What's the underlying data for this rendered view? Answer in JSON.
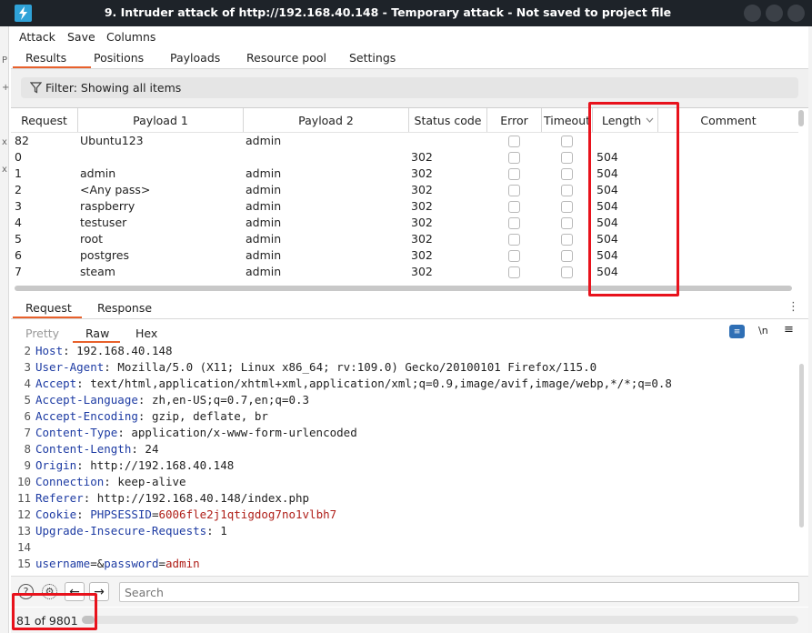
{
  "window": {
    "title": "9. Intruder attack of http://192.168.40.148 - Temporary attack - Not saved to project file",
    "icon": "burp-lightning-icon"
  },
  "left_strip": [
    "P",
    "+",
    "x",
    "x"
  ],
  "menu": [
    "Attack",
    "Save",
    "Columns"
  ],
  "tabs": [
    "Results",
    "Positions",
    "Payloads",
    "Resource pool",
    "Settings"
  ],
  "active_tab": "Results",
  "filter": {
    "text": "Filter: Showing all items",
    "icon": "filter-funnel-icon"
  },
  "results_table": {
    "columns": [
      "Request",
      "Payload 1",
      "Payload 2",
      "Status code",
      "Error",
      "Timeout",
      "Length",
      "Comment"
    ],
    "sort_column": "Length",
    "sort_icon": "chevron-down-icon",
    "rows": [
      {
        "request": "82",
        "payload1": "Ubuntu123",
        "payload2": "admin",
        "status": "",
        "length": ""
      },
      {
        "request": "0",
        "payload1": "",
        "payload2": "",
        "status": "302",
        "length": "504"
      },
      {
        "request": "1",
        "payload1": "admin",
        "payload2": "admin",
        "status": "302",
        "length": "504"
      },
      {
        "request": "2",
        "payload1": "<Any pass>",
        "payload2": "admin",
        "status": "302",
        "length": "504"
      },
      {
        "request": "3",
        "payload1": "raspberry",
        "payload2": "admin",
        "status": "302",
        "length": "504"
      },
      {
        "request": "4",
        "payload1": "testuser",
        "payload2": "admin",
        "status": "302",
        "length": "504"
      },
      {
        "request": "5",
        "payload1": "root",
        "payload2": "admin",
        "status": "302",
        "length": "504"
      },
      {
        "request": "6",
        "payload1": "postgres",
        "payload2": "admin",
        "status": "302",
        "length": "504"
      },
      {
        "request": "7",
        "payload1": "steam",
        "payload2": "admin",
        "status": "302",
        "length": "504"
      }
    ]
  },
  "message_tabs": [
    "Request",
    "Response"
  ],
  "view_tabs": [
    "Pretty",
    "Raw",
    "Hex"
  ],
  "active_view": "Raw",
  "view_buttons": {
    "newline": "\\n",
    "wrap_icon": "wrap-lines-icon",
    "menu_icon": "hamburger-icon"
  },
  "request_lines": [
    {
      "n": "2",
      "key": "Host",
      "value": " 192.168.40.148"
    },
    {
      "n": "3",
      "key": "User-Agent",
      "value": " Mozilla/5.0 (X11; Linux x86_64; rv:109.0) Gecko/20100101 Firefox/115.0"
    },
    {
      "n": "4",
      "key": "Accept",
      "value": " text/html,application/xhtml+xml,application/xml;q=0.9,image/avif,image/webp,*/*;q=0.8"
    },
    {
      "n": "5",
      "key": "Accept-Language",
      "value": " zh,en-US;q=0.7,en;q=0.3"
    },
    {
      "n": "6",
      "key": "Accept-Encoding",
      "value": " gzip, deflate, br"
    },
    {
      "n": "7",
      "key": "Content-Type",
      "value": " application/x-www-form-urlencoded"
    },
    {
      "n": "8",
      "key": "Content-Length",
      "value": " 24"
    },
    {
      "n": "9",
      "key": "Origin",
      "value": " http://192.168.40.148"
    },
    {
      "n": "10",
      "key": "Connection",
      "value": " keep-alive"
    },
    {
      "n": "11",
      "key": "Referer",
      "value": " http://192.168.40.148/index.php"
    },
    {
      "n": "12",
      "key": "Cookie",
      "value": " "
    },
    {
      "n": "13",
      "key": "Upgrade-Insecure-Requests",
      "value": " 1"
    },
    {
      "n": "14",
      "key": "",
      "value": ""
    },
    {
      "n": "15",
      "key": "",
      "value": ""
    }
  ],
  "cookie": {
    "name": "PHPSESSID",
    "eq": "=",
    "value": "6006fle2j1qtigdog7no1vlbh7"
  },
  "body_params": {
    "user_key": "username",
    "user_rest": "=&",
    "pass_key": "password",
    "eq": "=",
    "pass_value": "admin"
  },
  "search": {
    "placeholder": "Search",
    "help_icon": "help-icon",
    "settings_icon": "gear-icon",
    "back_icon": "arrow-left-icon",
    "forward_icon": "arrow-right-icon"
  },
  "status": {
    "text": "81 of 9801",
    "progress_fraction": 0.0083
  },
  "colors": {
    "accent": "#e8612c",
    "highlight": "#e8121c",
    "header_key": "#1d3ba3",
    "value_red": "#b0201a"
  }
}
